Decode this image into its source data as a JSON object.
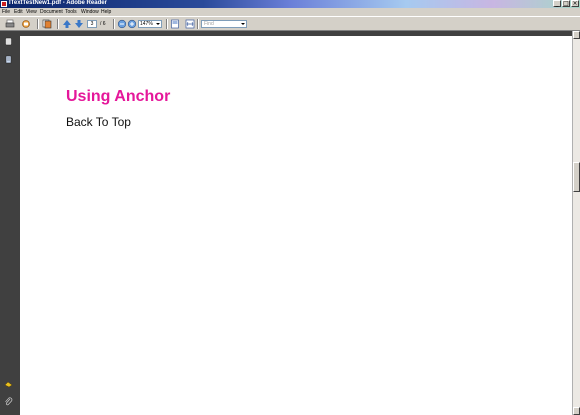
{
  "window": {
    "title": "ITextTestNew1.pdf - Adobe Reader"
  },
  "menubar": {
    "items": [
      "File",
      "Edit",
      "View",
      "Document",
      "Tools",
      "Window",
      "Help"
    ]
  },
  "toolbar": {
    "page_current": "3",
    "page_total": "/ 6",
    "zoom": "147%",
    "find_placeholder": "Find"
  },
  "document": {
    "heading": "Using Anchor",
    "link_text": "Back To Top"
  },
  "colors": {
    "heading": "#e5179a",
    "panel": "#404040",
    "chrome": "#d4d0c8"
  }
}
